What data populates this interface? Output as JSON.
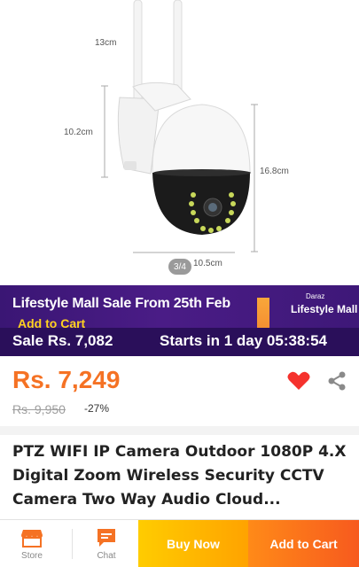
{
  "gallery": {
    "dimensions": {
      "antenna_height": "13cm",
      "body_height": "10.2cm",
      "total_height": "16.8cm",
      "width": "10.5cm"
    },
    "page_indicator": "3/4"
  },
  "promo": {
    "title": "Lifestyle Mall Sale From 25th Feb",
    "add_to_cart": "Add to Cart",
    "logo_small": "Daraz",
    "logo": "Lifestyle Mall",
    "sale_price": "Sale Rs. 7,082",
    "countdown": "Starts in 1 day 05:38:54",
    "colors": {
      "background": "#3a1674",
      "accent": "#ffd21f"
    }
  },
  "product": {
    "price": "Rs. 7,249",
    "original_price": "Rs. 9,950",
    "discount": "-27%",
    "title": "PTZ WIFI IP Camera Outdoor 1080P 4.X Digital Zoom Wireless Security CCTV Camera Two Way Audio Cloud...",
    "price_color": "#f57224"
  },
  "actions": {
    "favorite_icon": "heart-icon",
    "share_icon": "share-icon"
  },
  "bottom_bar": {
    "store_label": "Store",
    "chat_label": "Chat",
    "buy_now_label": "Buy Now",
    "add_to_cart_label": "Add to Cart"
  }
}
